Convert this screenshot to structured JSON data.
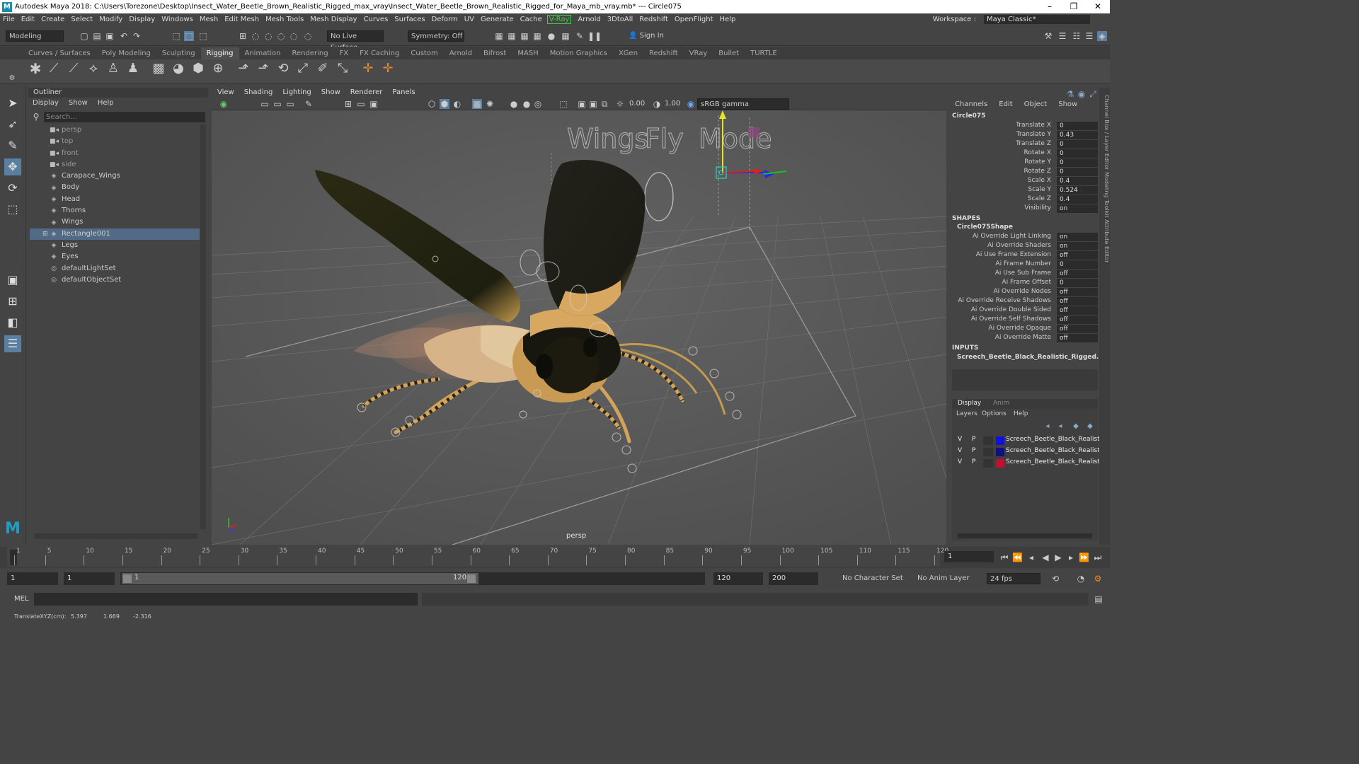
{
  "title": {
    "text": "Autodesk Maya 2018: C:\\Users\\Torezone\\Desktop\\Insect_Water_Beetle_Brown_Realistic_Rigged_max_vray\\Insect_Water_Beetle_Brown_Realistic_Rigged_for_Maya_mb_vray.mb*  ---  Circle075"
  },
  "menubar": {
    "items": [
      "File",
      "Edit",
      "Create",
      "Select",
      "Modify",
      "Display",
      "Windows",
      "Mesh",
      "Edit Mesh",
      "Mesh Tools",
      "Mesh Display",
      "Curves",
      "Surfaces",
      "Deform",
      "UV",
      "Generate",
      "Cache"
    ],
    "vray": "V-Ray",
    "items2": [
      "Arnold",
      "3DtoAll",
      "Redshift",
      "OpenFlight",
      "Help"
    ],
    "workspace_label": "Workspace :",
    "workspace_value": "Maya Classic*"
  },
  "statusline": {
    "mode": "Modeling",
    "live_surface": "No Live Surface",
    "symmetry": "Symmetry: Off",
    "sign_in": "Sign In"
  },
  "shelf": {
    "tabs": [
      "Curves / Surfaces",
      "Poly Modeling",
      "Sculpting",
      "Rigging",
      "Animation",
      "Rendering",
      "FX",
      "FX Caching",
      "Custom",
      "Arnold",
      "Bifrost",
      "MASH",
      "Motion Graphics",
      "XGen",
      "Redshift",
      "VRay",
      "Bullet",
      "TURTLE"
    ],
    "active": "Rigging"
  },
  "outliner": {
    "title": "Outliner",
    "menu": [
      "Display",
      "Show",
      "Help"
    ],
    "search_placeholder": "Search...",
    "items": [
      {
        "label": "persp",
        "type": "camera"
      },
      {
        "label": "top",
        "type": "camera"
      },
      {
        "label": "front",
        "type": "camera"
      },
      {
        "label": "side",
        "type": "camera"
      },
      {
        "label": "Carapace_Wings",
        "type": "transform"
      },
      {
        "label": "Body",
        "type": "transform"
      },
      {
        "label": "Head",
        "type": "transform"
      },
      {
        "label": "Thorns",
        "type": "transform"
      },
      {
        "label": "Wings",
        "type": "transform"
      },
      {
        "label": "Rectangle001",
        "type": "transform",
        "selected": true
      },
      {
        "label": "Legs",
        "type": "transform"
      },
      {
        "label": "Eyes",
        "type": "transform"
      },
      {
        "label": "defaultLightSet",
        "type": "set"
      },
      {
        "label": "defaultObjectSet",
        "type": "set"
      }
    ]
  },
  "viewport": {
    "menu": [
      "View",
      "Shading",
      "Lighting",
      "Show",
      "Renderer",
      "Panels"
    ],
    "exposure": "0.00",
    "gamma": "1.00",
    "colorspace": "sRGB gamma",
    "camera_label": "persp",
    "scene_text": [
      "Wings",
      "Fly",
      "Mode"
    ]
  },
  "channelbox": {
    "menu": [
      "Channels",
      "Edit",
      "Object",
      "Show"
    ],
    "object": "Circle075",
    "channels": [
      {
        "label": "Translate X",
        "value": "0"
      },
      {
        "label": "Translate Y",
        "value": "0.43"
      },
      {
        "label": "Translate Z",
        "value": "0"
      },
      {
        "label": "Rotate X",
        "value": "0"
      },
      {
        "label": "Rotate Y",
        "value": "0"
      },
      {
        "label": "Rotate Z",
        "value": "0"
      },
      {
        "label": "Scale X",
        "value": "0.4"
      },
      {
        "label": "Scale Y",
        "value": "0.524"
      },
      {
        "label": "Scale Z",
        "value": "0.4"
      },
      {
        "label": "Visibility",
        "value": "on"
      }
    ],
    "shapes_label": "SHAPES",
    "shape_name": "Circle075Shape",
    "shape_attrs": [
      {
        "label": "Ai Override Light Linking",
        "value": "on"
      },
      {
        "label": "Ai Override Shaders",
        "value": "on"
      },
      {
        "label": "Ai Use Frame Extension",
        "value": "off"
      },
      {
        "label": "Ai Frame Number",
        "value": "0"
      },
      {
        "label": "Ai Use Sub Frame",
        "value": "off"
      },
      {
        "label": "Ai Frame Offset",
        "value": "0"
      },
      {
        "label": "Ai Override Nodes",
        "value": "off"
      },
      {
        "label": "Ai Override Receive Shadows",
        "value": "off"
      },
      {
        "label": "Ai Override Double Sided",
        "value": "off"
      },
      {
        "label": "Ai Override Self Shadows",
        "value": "off"
      },
      {
        "label": "Ai Override Opaque",
        "value": "off"
      },
      {
        "label": "Ai Override Matte",
        "value": "off"
      }
    ],
    "inputs_label": "INPUTS",
    "input_name": "Screech_Beetle_Black_Realistic_Rigged..."
  },
  "layers": {
    "tabs": [
      "Display",
      "Anim"
    ],
    "menu": [
      "Layers",
      "Options",
      "Help"
    ],
    "rows": [
      {
        "v": "V",
        "p": "P",
        "color": "#1010e0",
        "name": "Screech_Beetle_Black_Realistic_"
      },
      {
        "v": "V",
        "p": "P",
        "color": "#101080",
        "name": "Screech_Beetle_Black_Realistic_"
      },
      {
        "v": "V",
        "p": "P",
        "color": "#c01030",
        "name": "Screech_Beetle_Black_Realistic_"
      }
    ]
  },
  "side_tabs": "Channel Box / Layer Editor   Modeling Toolkit   Attribute Editor",
  "timeslider": {
    "ticks": [
      "1",
      "5",
      "10",
      "15",
      "20",
      "25",
      "30",
      "35",
      "40",
      "45",
      "50",
      "55",
      "60",
      "65",
      "70",
      "75",
      "80",
      "85",
      "90",
      "95",
      "100",
      "105",
      "110",
      "115",
      "120"
    ],
    "current": "1"
  },
  "range": {
    "start": "1",
    "start2": "1",
    "slider_start": "1",
    "slider_end": "120",
    "end": "120",
    "end2": "200",
    "char_set": "No Character Set",
    "anim_layer": "No Anim Layer",
    "fps": "24 fps"
  },
  "cmdline": {
    "label": "MEL"
  },
  "helpline": {
    "label": "TranslateXYZ(cm):",
    "x": "5.397",
    "y": "1.669",
    "z": "-2.316"
  }
}
